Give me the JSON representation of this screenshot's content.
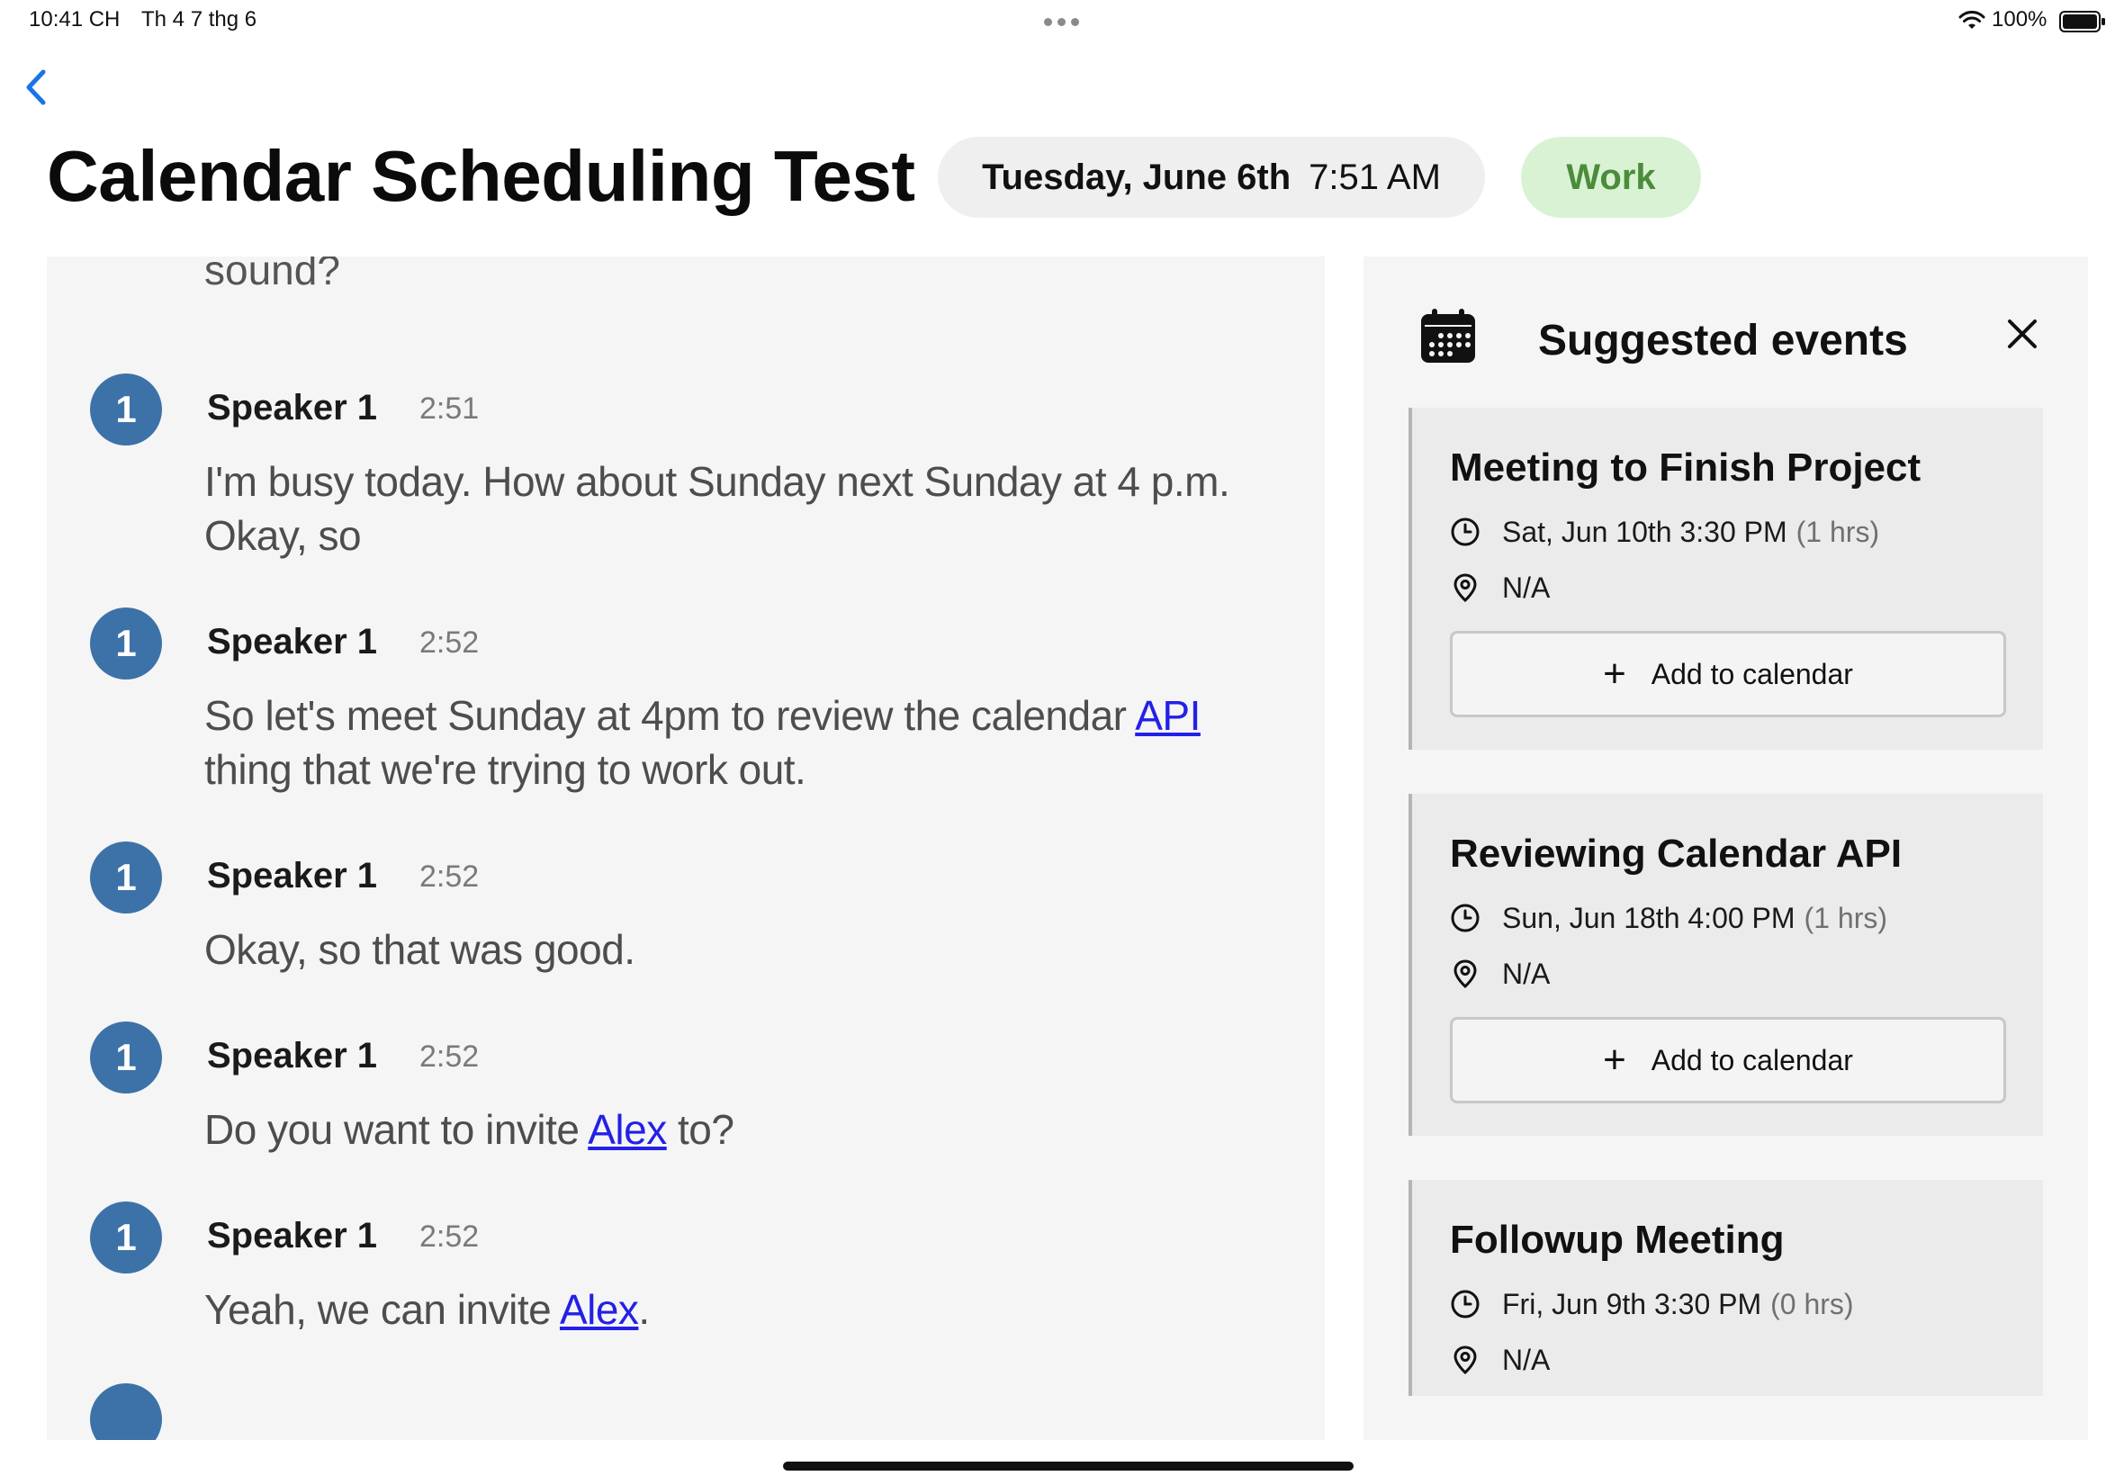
{
  "status_bar": {
    "time": "10:41 CH",
    "date": "Th 4 7 thg 6",
    "battery": "100%"
  },
  "header": {
    "title": "Calendar Scheduling Test",
    "date": "Tuesday, June 6th",
    "time": "7:51 AM",
    "tag": "Work"
  },
  "transcript": {
    "cut_text": "sound?",
    "messages": [
      {
        "avatar": "1",
        "speaker": "Speaker 1",
        "time": "2:51",
        "text": "I'm busy today. How about Sunday next Sunday at 4 p.m. Okay, so"
      },
      {
        "avatar": "1",
        "speaker": "Speaker 1",
        "time": "2:52",
        "text_before": "So let's meet Sunday at 4pm to review the calendar ",
        "link": "API",
        "text_after": " thing that we're trying to work out."
      },
      {
        "avatar": "1",
        "speaker": "Speaker 1",
        "time": "2:52",
        "text": "Okay, so that was good."
      },
      {
        "avatar": "1",
        "speaker": "Speaker 1",
        "time": "2:52",
        "text_before": "Do you want to invite ",
        "link": "Alex",
        "text_after": " to?"
      },
      {
        "avatar": "1",
        "speaker": "Speaker 1",
        "time": "2:52",
        "text_before": "Yeah, we can invite ",
        "link": "Alex",
        "text_after": "."
      }
    ]
  },
  "suggested": {
    "title": "Suggested events",
    "icons": {
      "panel": "calendar-icon",
      "close": "close-icon",
      "time": "clock-icon",
      "location": "location-pin-icon",
      "add": "plus-icon"
    },
    "events": [
      {
        "title": "Meeting to Finish Project",
        "datetime": "Sat, Jun 10th 3:30 PM",
        "duration": "(1 hrs)",
        "location": "N/A",
        "button": "Add to calendar"
      },
      {
        "title": "Reviewing Calendar API",
        "datetime": "Sun, Jun 18th 4:00 PM",
        "duration": "(1 hrs)",
        "location": "N/A",
        "button": "Add to calendar"
      },
      {
        "title": "Followup Meeting",
        "datetime": "Fri, Jun 9th 3:30 PM",
        "duration": "(0 hrs)",
        "location": "N/A"
      }
    ]
  },
  "colors": {
    "avatar": "#3c72a8",
    "link": "#2320e8",
    "tag_bg": "#d9f2d3",
    "tag_text": "#4a8c3a",
    "back": "#1a73e8"
  }
}
